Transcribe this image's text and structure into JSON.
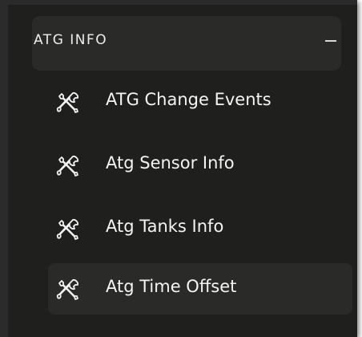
{
  "section": {
    "title": "ATG INFO",
    "collapse_icon": "minus-icon",
    "expanded": true
  },
  "items": [
    {
      "label": "ATG Change Events",
      "icon": "tools-icon",
      "active": false
    },
    {
      "label": "Atg Sensor Info",
      "icon": "tools-icon",
      "active": false
    },
    {
      "label": "Atg Tanks Info",
      "icon": "tools-icon",
      "active": false
    },
    {
      "label": "Atg Time Offset",
      "icon": "tools-icon",
      "active": true
    }
  ],
  "colors": {
    "panel_bg": "#1f201e",
    "highlight_bg": "#2a2b28",
    "text": "#f4f4f4"
  }
}
